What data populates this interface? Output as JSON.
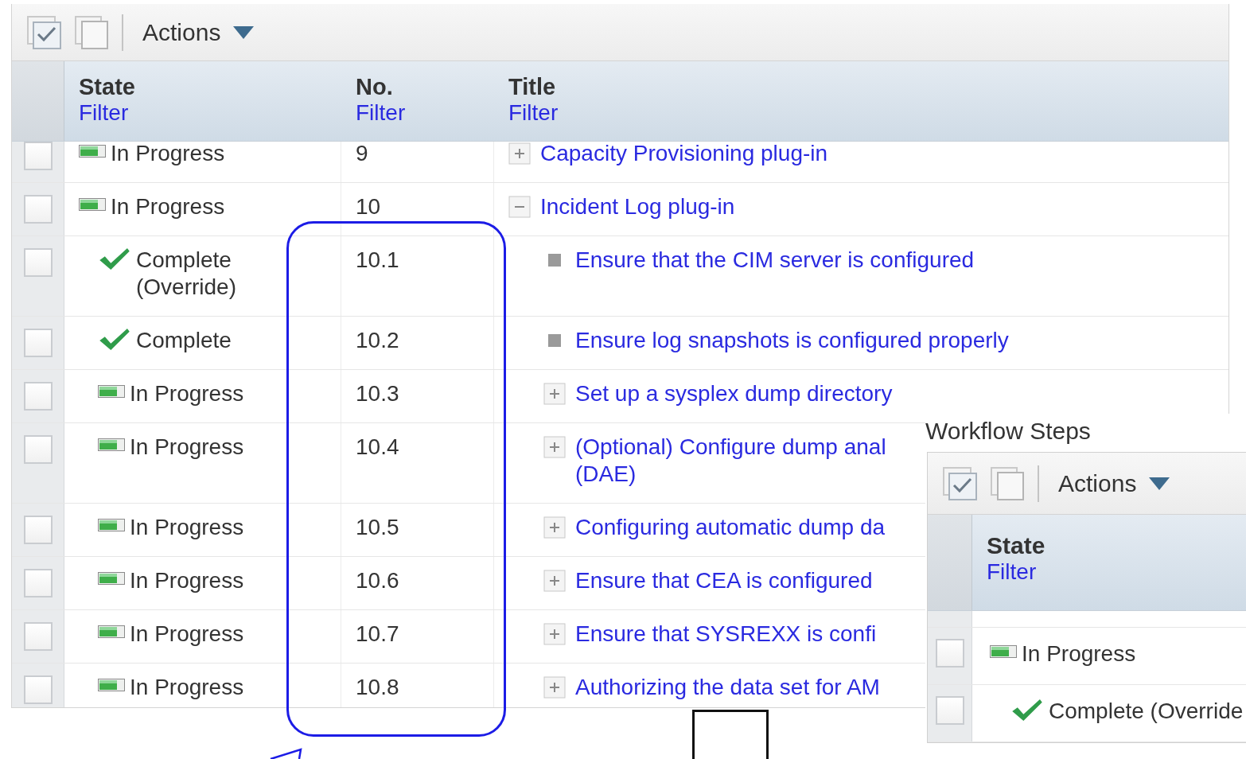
{
  "toolbar": {
    "actions_label": "Actions"
  },
  "columns": [
    {
      "label": "State",
      "filter": "Filter"
    },
    {
      "label": "No.",
      "filter": "Filter"
    },
    {
      "label": "Title",
      "filter": "Filter"
    }
  ],
  "rows": [
    {
      "checked": false,
      "kind": "in_progress",
      "state": "In Progress",
      "number": "9",
      "title": "Capacity Provisioning plug-in",
      "leaf": false,
      "expanded": false
    },
    {
      "checked": false,
      "kind": "in_progress",
      "state": "In Progress",
      "number": "10",
      "title": "Incident Log plug-in",
      "leaf": false,
      "expanded": true,
      "children": [
        {
          "checked": false,
          "kind": "complete",
          "state": "Complete (Override)",
          "number": "10.1",
          "title": "Ensure that the CIM server is configured",
          "leaf": true
        },
        {
          "checked": false,
          "kind": "complete",
          "state": "Complete",
          "number": "10.2",
          "title": "Ensure log snapshots is configured properly",
          "leaf": true
        },
        {
          "checked": false,
          "kind": "in_progress",
          "state": "In Progress",
          "number": "10.3",
          "title": "Set up a sysplex dump directory",
          "leaf": false,
          "expanded": false
        },
        {
          "checked": false,
          "kind": "in_progress",
          "state": "In Progress",
          "number": "10.4",
          "title": "(Optional) Configure dump anal\n(DAE)",
          "leaf": false,
          "expanded": false
        },
        {
          "checked": false,
          "kind": "in_progress",
          "state": "In Progress",
          "number": "10.5",
          "title": "Configuring automatic dump da",
          "leaf": false,
          "expanded": false
        },
        {
          "checked": false,
          "kind": "in_progress",
          "state": "In Progress",
          "number": "10.6",
          "title": "Ensure that CEA is configured",
          "leaf": false,
          "expanded": false
        },
        {
          "checked": false,
          "kind": "in_progress",
          "state": "In Progress",
          "number": "10.7",
          "title": "Ensure that SYSREXX is confi",
          "leaf": false,
          "expanded": false
        },
        {
          "checked": false,
          "kind": "in_progress",
          "state": "In Progress",
          "number": "10.8",
          "title": "Authorizing the data set for AM",
          "leaf": false,
          "expanded": false
        }
      ]
    }
  ],
  "overlay": {
    "title": "Workflow Steps",
    "toolbar": {
      "actions_label": "Actions"
    },
    "columns": [
      {
        "label": "State",
        "filter": "Filter"
      }
    ],
    "rows": [
      {
        "checked": false,
        "kind": "in_progress",
        "state": "In Progress"
      },
      {
        "checked": false,
        "kind": "complete",
        "state": "Complete (Override"
      }
    ]
  }
}
